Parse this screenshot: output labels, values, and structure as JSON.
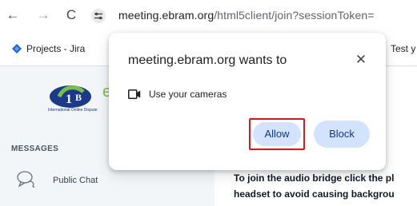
{
  "browser": {
    "url_host": "meeting.ebram.org",
    "url_path": "/html5client/join?sessionToken="
  },
  "bookmarks": {
    "items": [
      "Projects - Jira",
      "Test y"
    ]
  },
  "sidebar": {
    "logo_text": "International Online Dispute",
    "messages_header": "MESSAGES",
    "public_chat_label": "Public Chat"
  },
  "content": {
    "lines": [
      "To join the audio bridge click the pl",
      "headset to avoid causing backgrou"
    ]
  },
  "permission_dialog": {
    "title": "meeting.ebram.org wants to",
    "close_glyph": "✕",
    "permission_text": "Use your cameras",
    "allow_label": "Allow",
    "block_label": "Block"
  },
  "colors": {
    "button_bg": "#d3e3fd",
    "button_text": "#0b3a86",
    "highlight": "#e0161c"
  }
}
